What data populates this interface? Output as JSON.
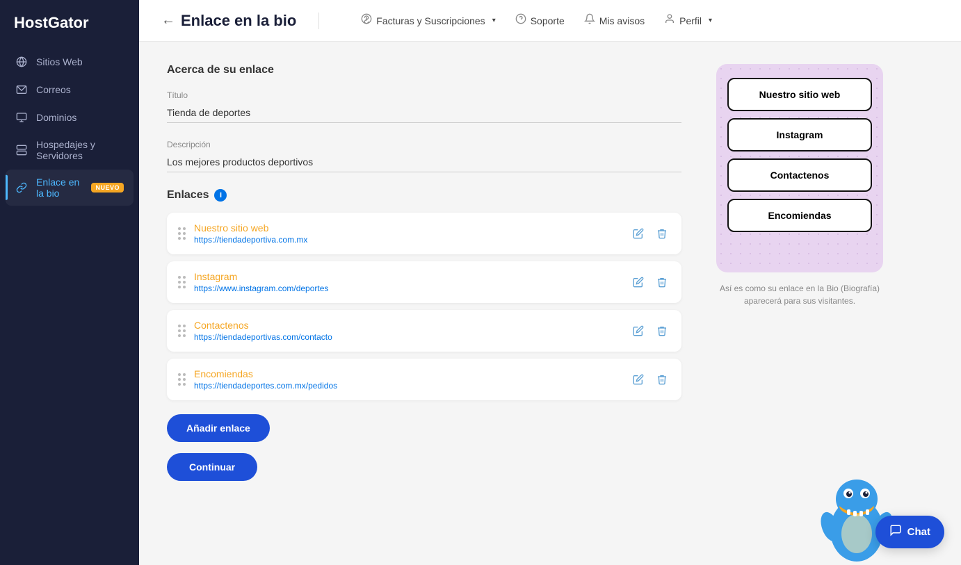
{
  "sidebar": {
    "logo": "HostGator",
    "items": [
      {
        "id": "sitios-web",
        "label": "Sitios Web",
        "icon": "globe"
      },
      {
        "id": "correos",
        "label": "Correos",
        "icon": "mail"
      },
      {
        "id": "dominios",
        "label": "Dominios",
        "icon": "domain"
      },
      {
        "id": "hospedajes",
        "label": "Hospedajes y Servidores",
        "icon": "server"
      },
      {
        "id": "enlace-bio",
        "label": "Enlace en la bio",
        "icon": "link",
        "active": true,
        "badge": "NUEVO"
      }
    ]
  },
  "header": {
    "back_arrow": "←",
    "title": "Enlace en la bio",
    "nav_items": [
      {
        "id": "facturas",
        "label": "Facturas y Suscripciones",
        "icon": "$",
        "has_dropdown": true
      },
      {
        "id": "soporte",
        "label": "Soporte",
        "icon": "?",
        "has_dropdown": false
      },
      {
        "id": "avisos",
        "label": "Mis avisos",
        "icon": "bell",
        "has_dropdown": false
      },
      {
        "id": "perfil",
        "label": "Perfil",
        "icon": "user",
        "has_dropdown": true
      }
    ]
  },
  "form": {
    "section_title": "Acerca de su enlace",
    "title_label": "Título",
    "title_value": "Tienda de deportes",
    "description_label": "Descripción",
    "description_value": "Los mejores productos deportivos",
    "enlaces_label": "Enlaces",
    "links": [
      {
        "id": "link-1",
        "name": "Nuestro sitio web",
        "url": "https://tiendadeportiva.com.mx"
      },
      {
        "id": "link-2",
        "name": "Instagram",
        "url": "https://www.instagram.com/deportes"
      },
      {
        "id": "link-3",
        "name": "Contactenos",
        "url": "https://tiendadeportivas.com/contacto"
      },
      {
        "id": "link-4",
        "name": "Encomiendas",
        "url": "https://tiendadeportes.com.mx/pedidos"
      }
    ],
    "add_button_label": "Añadir enlace",
    "continue_button_label": "Continuar"
  },
  "preview": {
    "buttons": [
      {
        "label": "Nuestro sitio web"
      },
      {
        "label": "Instagram"
      },
      {
        "label": "Contactenos"
      },
      {
        "label": "Encomiendas"
      }
    ],
    "caption": "Así es como su enlace en la Bio (Biografía) aparecerá para sus visitantes."
  },
  "chat": {
    "label": "Chat"
  },
  "icons": {
    "globe": "🌐",
    "mail": "✉",
    "domain": "🖥",
    "server": "🗄",
    "link": "🔗",
    "bell": "🔔",
    "user": "👤",
    "dollar": "💲",
    "question": "?",
    "pencil": "✏",
    "trash": "🗑",
    "drag": "⋮⋮",
    "chat_bubble": "💬"
  }
}
